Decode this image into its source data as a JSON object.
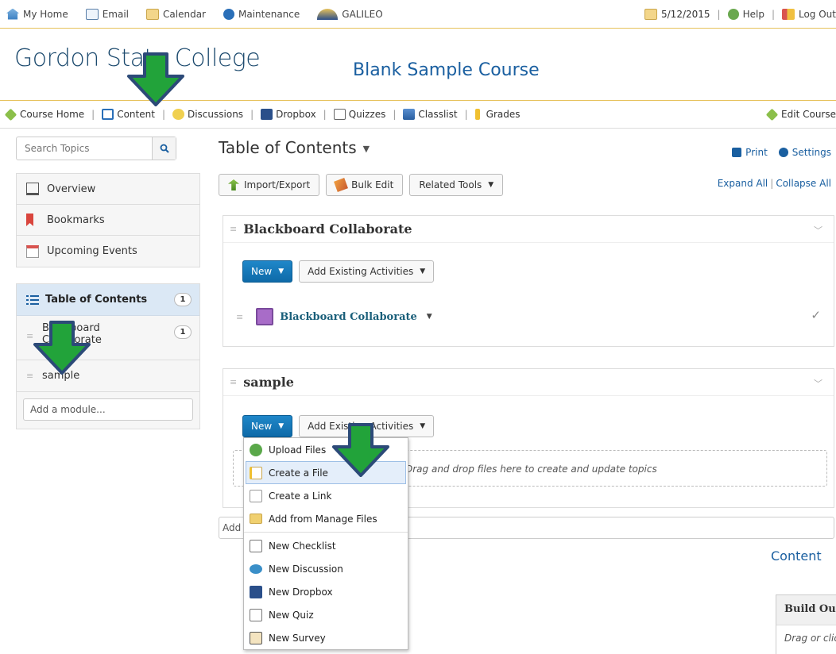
{
  "minibar": {
    "items": [
      {
        "label": "My Home",
        "icon": "home-icon"
      },
      {
        "label": "Email",
        "icon": "email-icon"
      },
      {
        "label": "Calendar",
        "icon": "calendar-icon"
      },
      {
        "label": "Maintenance",
        "icon": "maintenance-icon"
      },
      {
        "label": "GALILEO",
        "icon": "galileo-icon"
      }
    ],
    "date": "5/12/2015",
    "help": "Help",
    "logout": "Log Out"
  },
  "header": {
    "org_name": "Gordon State College",
    "course_name": "Blank Sample Course"
  },
  "navbar": {
    "items": [
      {
        "label": "Course Home",
        "icon": "course-home-icon"
      },
      {
        "label": "Content",
        "icon": "content-book-icon"
      },
      {
        "label": "Discussions",
        "icon": "discussions-icon"
      },
      {
        "label": "Dropbox",
        "icon": "dropbox-icon"
      },
      {
        "label": "Quizzes",
        "icon": "quizzes-icon"
      },
      {
        "label": "Classlist",
        "icon": "classlist-icon"
      },
      {
        "label": "Grades",
        "icon": "grades-icon"
      }
    ],
    "edit_course": "Edit Course"
  },
  "sidebar": {
    "search_placeholder": "Search Topics",
    "items": [
      {
        "label": "Overview",
        "icon": "overview-icon"
      },
      {
        "label": "Bookmarks",
        "icon": "bookmark-icon"
      },
      {
        "label": "Upcoming Events",
        "icon": "events-calendar-icon"
      }
    ],
    "toc": {
      "label": "Table of Contents",
      "count": "1",
      "modules": [
        {
          "line1": "Blackboard",
          "line2": "Collaborate",
          "count": "1"
        },
        {
          "line1": "sample",
          "line2": "",
          "count": ""
        }
      ]
    },
    "add_module_placeholder": "Add a module..."
  },
  "main": {
    "title": "Table of Contents",
    "print": "Print",
    "settings": "Settings",
    "expand_all": "Expand All",
    "collapse_all": "Collapse All",
    "buttons": {
      "import_export": "Import/Export",
      "bulk_edit": "Bulk Edit",
      "related_tools": "Related Tools"
    },
    "modules": [
      {
        "title": "Blackboard Collaborate",
        "new_label": "New",
        "add_existing": "Add Existing Activities",
        "topic": "Blackboard Collaborate"
      },
      {
        "title": "sample",
        "new_label": "New",
        "add_existing": "Add Existing Activities"
      }
    ],
    "dropzone_text": "Drag and drop files here to create and update topics",
    "add_placeholder": "Add",
    "content_link": "Content",
    "build_outline_title": "Build Outline",
    "build_outline_text": "Drag or click"
  },
  "new_menu": {
    "items": [
      {
        "label": "Upload Files",
        "icon": "upload-icon"
      },
      {
        "label": "Create a File",
        "icon": "create-file-icon",
        "highlighted": true
      },
      {
        "label": "Create a Link",
        "icon": "link-icon"
      },
      {
        "label": "Add from Manage Files",
        "icon": "folder-icon"
      },
      {
        "label": "New Checklist",
        "icon": "checklist-icon"
      },
      {
        "label": "New Discussion",
        "icon": "discussion-icon"
      },
      {
        "label": "New Dropbox",
        "icon": "dropbox-icon"
      },
      {
        "label": "New Quiz",
        "icon": "quiz-icon"
      },
      {
        "label": "New Survey",
        "icon": "survey-icon"
      }
    ]
  },
  "colors": {
    "accent_gold": "#e6c15a",
    "link_blue": "#1a5fa0",
    "new_button_blue": "#0e6aa8",
    "arrow_green": "#22a33a",
    "arrow_outline": "#2c4a78"
  }
}
